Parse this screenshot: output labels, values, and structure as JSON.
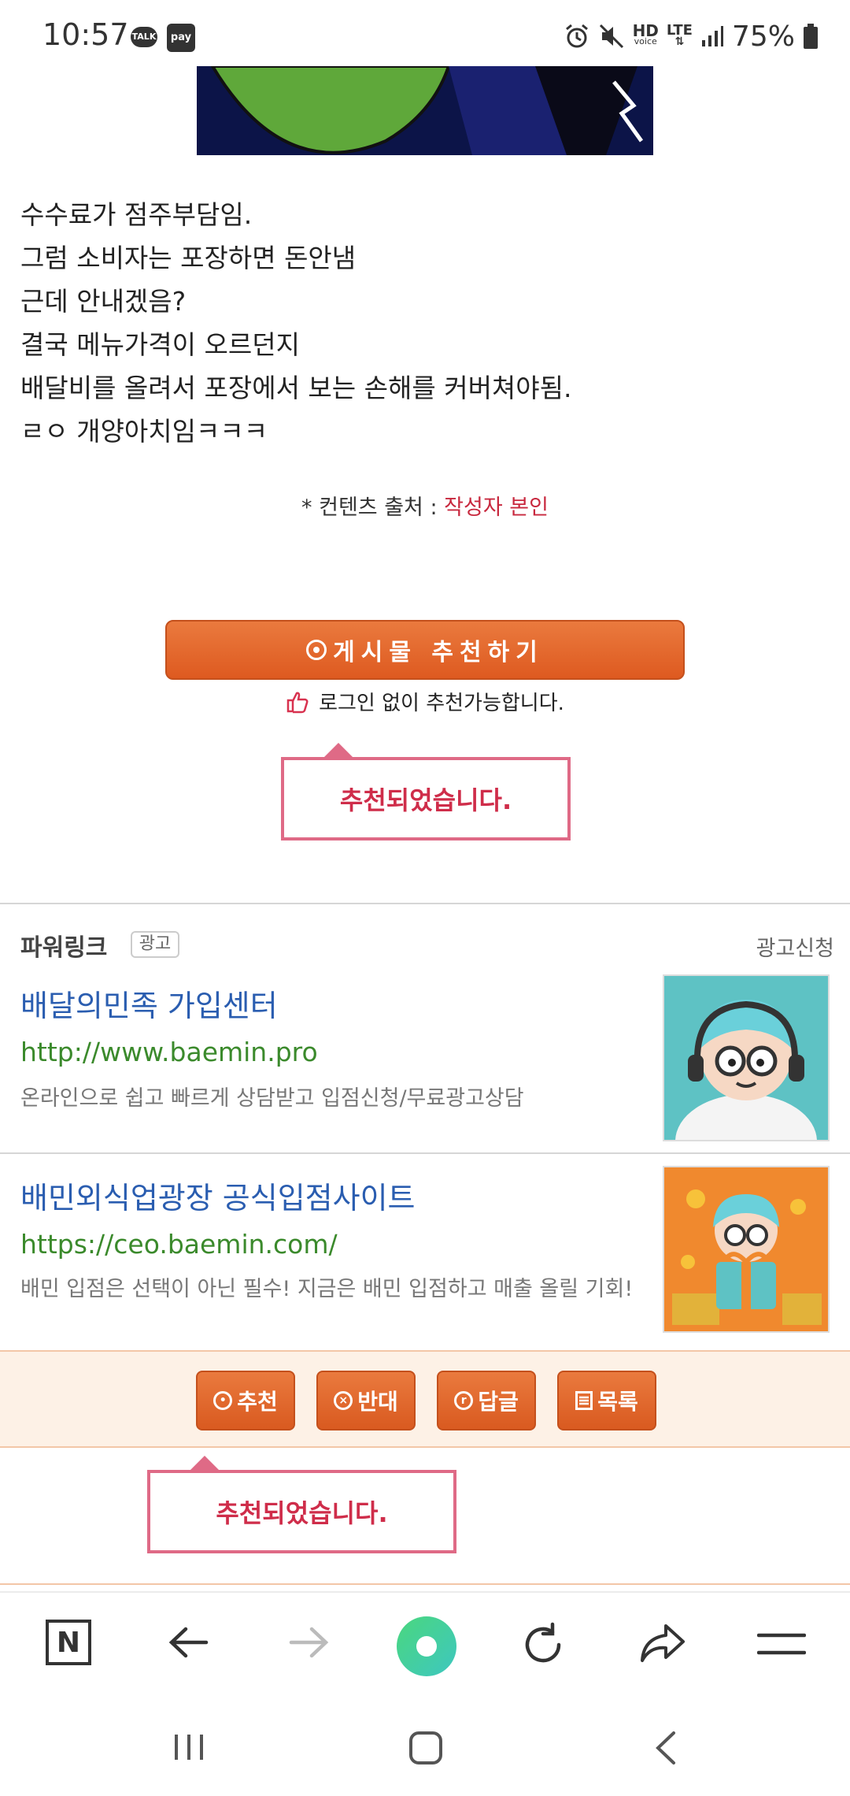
{
  "status_bar": {
    "time": "10:57",
    "talk_badge": "TALK",
    "pay_badge": "pay",
    "hd_label": "HD",
    "voice_label": "voice",
    "lte_label": "LTE",
    "battery": "75%"
  },
  "post": {
    "lines": [
      "수수료가 점주부담임.",
      "그럼 소비자는 포장하면 돈안냄",
      "근데 안내겠음?",
      "결국 메뉴가격이 오르던지",
      "배달비를 올려서 포장에서 보는 손해를 커버쳐야됨.",
      "ㄹㅇ 개양아치임ㅋㅋㅋ"
    ],
    "source_prefix": "* 컨텐츠 출처 : ",
    "source_link": "작성자 본인"
  },
  "recommend": {
    "button_label": "게시물  추천하기",
    "note": "로그인 없이 추천가능합니다.",
    "tooltip": "추천되었습니다."
  },
  "power_link": {
    "title": "파워링크",
    "tag": "광고",
    "apply": "광고신청",
    "ads": [
      {
        "title": "배달의민족 가입센터",
        "url": "http://www.baemin.pro",
        "desc": "온라인으로 쉽고 빠르게 상담받고 입점신청/무료광고상담"
      },
      {
        "title": "배민외식업광장 공식입점사이트",
        "url": "https://ceo.baemin.com/",
        "desc": "배민 입점은 선택이 아닌 필수! 지금은 배민 입점하고 매출 올릴 기회!"
      }
    ]
  },
  "actions": {
    "recommend": "추천",
    "oppose": "반대",
    "reply": "답글",
    "list": "목록",
    "tooltip": "추천되었습니다."
  },
  "browser": {
    "home_icon_letter": "N"
  },
  "colors": {
    "accent_orange": "#de5a20",
    "tooltip_pink": "#df6a86",
    "link_blue": "#2a5db0",
    "url_green": "#3b8a2c",
    "source_red": "#c8283e"
  }
}
